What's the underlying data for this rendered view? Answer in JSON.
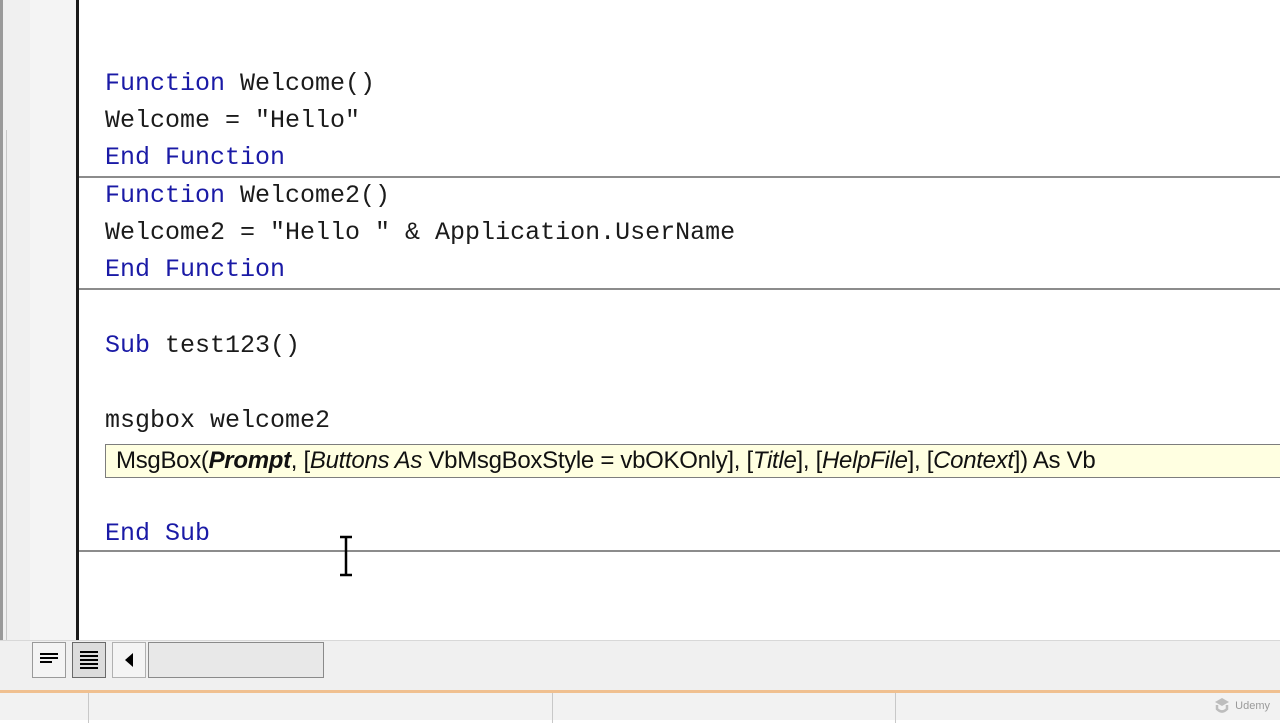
{
  "code": {
    "func1_kw1": "Function",
    "func1_name": " Welcome()",
    "func1_body": "Welcome = \"Hello\"",
    "func1_end_kw1": "End",
    "func1_end_kw2": " Function",
    "func2_kw1": "Function",
    "func2_name": " Welcome2()",
    "func2_body": "Welcome2 = \"Hello \" & Application.UserName",
    "func2_end_kw1": "End",
    "func2_end_kw2": " Function",
    "sub_kw": "Sub",
    "sub_name": " test123()",
    "msgbox_line": "msgbox welcome2",
    "endsub_kw1": "End",
    "endsub_kw2": " Sub"
  },
  "tooltip": {
    "prefix": "MsgBox(",
    "prompt": "Prompt",
    "part1": ", [",
    "buttons": "Buttons As",
    "part2": " VbMsgBoxStyle = vbOKOnly], [",
    "title": "Title",
    "part3": "], [",
    "helpfile": "HelpFile",
    "part4": "], [",
    "context": "Context",
    "part5": "]) As Vb"
  },
  "watermark": {
    "text": "Udemy"
  },
  "colors": {
    "keyword": "#1a1aa6",
    "text": "#1b1b1b",
    "tooltip_bg": "#ffffe1"
  }
}
